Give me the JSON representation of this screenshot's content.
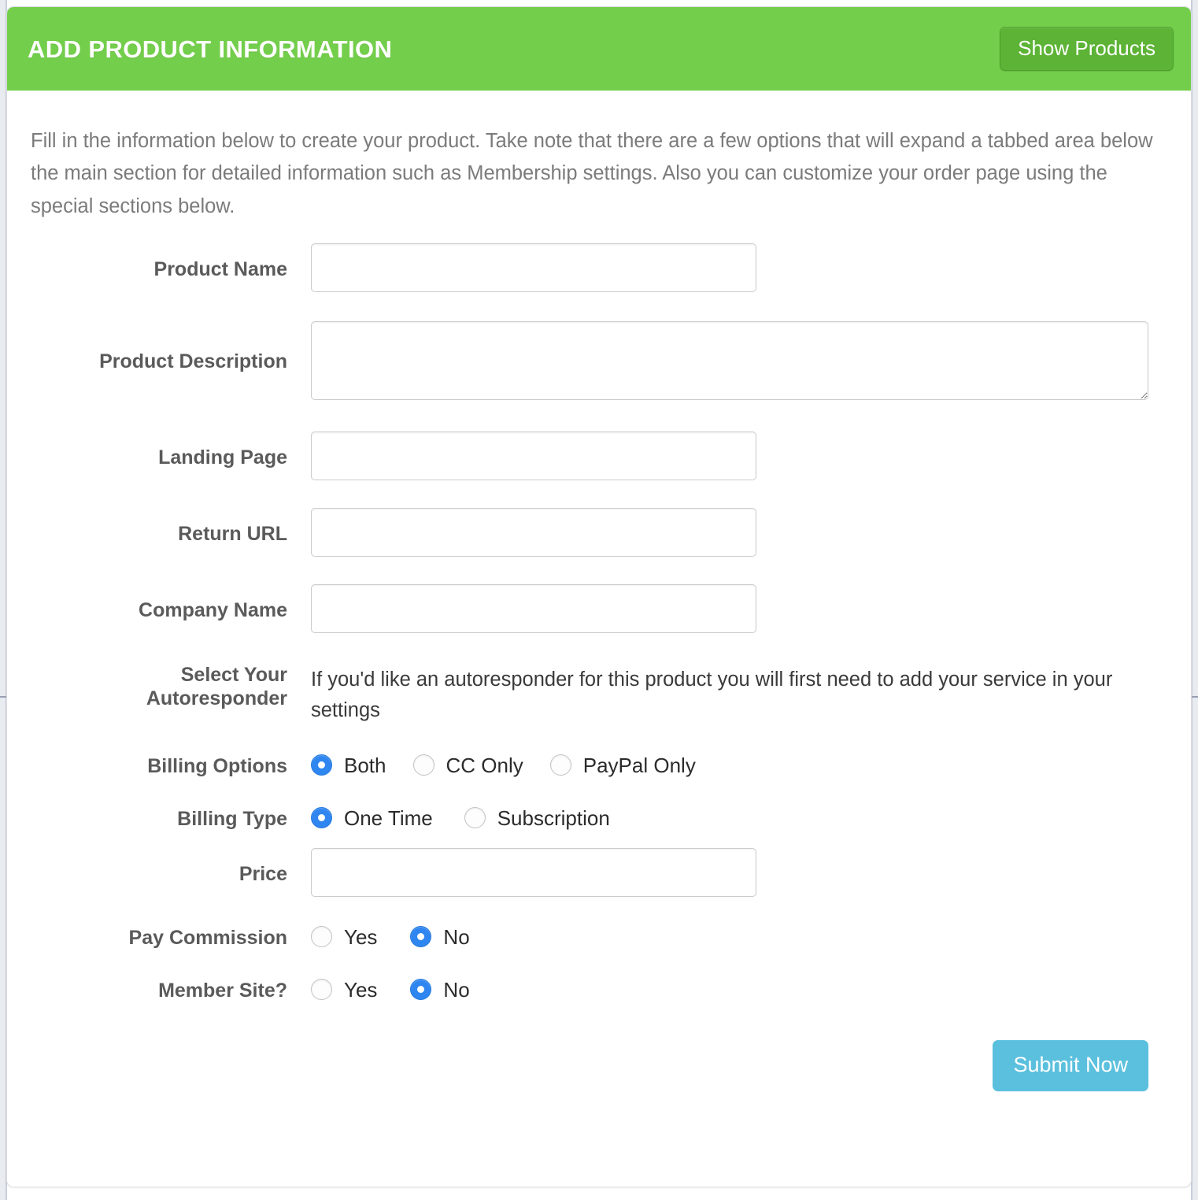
{
  "header": {
    "title": "ADD PRODUCT INFORMATION",
    "show_products_label": "Show Products",
    "bar_color": "#73ce4b",
    "button_color": "#5cb335"
  },
  "intro": {
    "text": "Fill in the information below to create your product. Take note that there are a few options that will expand a tabbed area below the main section for detailed information such as Membership settings. Also you can customize your order page using the special sections below."
  },
  "form": {
    "product_name": {
      "label": "Product Name",
      "value": "",
      "placeholder": ""
    },
    "product_description": {
      "label": "Product Description",
      "value": "",
      "placeholder": ""
    },
    "landing_page": {
      "label": "Landing Page",
      "value": "",
      "placeholder": ""
    },
    "return_url": {
      "label": "Return URL",
      "value": "",
      "placeholder": ""
    },
    "company_name": {
      "label": "Company Name",
      "value": "",
      "placeholder": ""
    },
    "autoresponder": {
      "label_line1": "Select Your",
      "label_line2": "Autoresponder",
      "help": "If you'd like an autoresponder for this product you will first need to add your service in your settings"
    },
    "billing_options": {
      "label": "Billing Options",
      "options": [
        {
          "label": "Both",
          "selected": true
        },
        {
          "label": "CC Only",
          "selected": false
        },
        {
          "label": "PayPal Only",
          "selected": false
        }
      ]
    },
    "billing_type": {
      "label": "Billing Type",
      "options": [
        {
          "label": "One Time",
          "selected": true
        },
        {
          "label": "Subscription",
          "selected": false
        }
      ]
    },
    "price": {
      "label": "Price",
      "value": "",
      "placeholder": ""
    },
    "pay_commission": {
      "label": "Pay Commission",
      "options": [
        {
          "label": "Yes",
          "selected": false
        },
        {
          "label": "No",
          "selected": true
        }
      ]
    },
    "member_site": {
      "label": "Member Site?",
      "options": [
        {
          "label": "Yes",
          "selected": false
        },
        {
          "label": "No",
          "selected": true
        }
      ]
    }
  },
  "footer": {
    "submit_label": "Submit Now",
    "submit_color": "#5bc0de"
  },
  "accent": {
    "radio_selected": "#2f86f0",
    "label_text": "#5a5a5a",
    "body_text": "#7b7b7b"
  }
}
